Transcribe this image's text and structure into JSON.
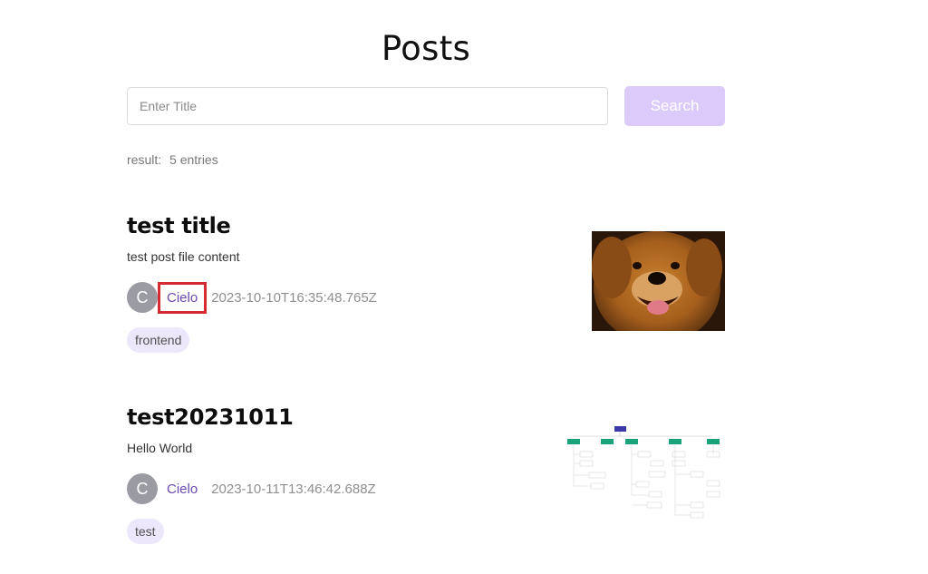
{
  "page": {
    "title": "Posts"
  },
  "search": {
    "placeholder": "Enter Title",
    "button_label": "Search"
  },
  "result": {
    "label": "result:",
    "count": "5 entries"
  },
  "posts": [
    {
      "title": "test title",
      "content": "test post file content",
      "avatar_initial": "C",
      "author": "Cielo",
      "date": "2023-10-10T16:35:48.765Z",
      "tag": "frontend",
      "thumbnail": "dog-photo"
    },
    {
      "title": "test20231011",
      "content": "Hello World",
      "avatar_initial": "C",
      "author": "Cielo",
      "date": "2023-10-11T13:46:42.688Z",
      "tag": "test",
      "thumbnail": "tree-diagram"
    }
  ],
  "colors": {
    "accent": "#6a4ab0",
    "button_bg": "#dccbfa",
    "tag_bg": "#ece7fb",
    "highlight": "#d62a33"
  }
}
